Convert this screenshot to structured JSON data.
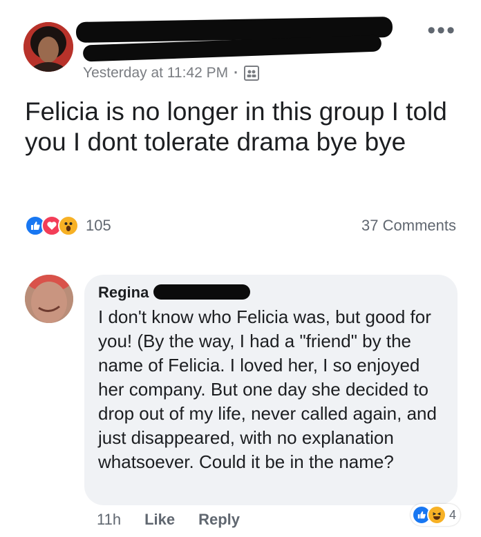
{
  "post": {
    "timestamp": "Yesterday at 11:42 PM",
    "separator": "·",
    "more_label": "•••",
    "text": "Felicia is no longer in this group I told you I dont tolerate drama bye bye",
    "reaction_count": "105",
    "comments_label": "37 Comments",
    "reactions": [
      "like",
      "love",
      "wow"
    ],
    "colors": {
      "like": "#1877f2",
      "love": "#f33e58",
      "wow": "#f7b125"
    }
  },
  "comment": {
    "author": "Regina",
    "text": "I don't know who Felicia was, but good for you! (By the way, I had a \"friend\" by the name of Felicia. I loved her, I so enjoyed her company. But one day she decided to drop out of my life, never called again, and just disappeared, with no explanation whatsoever. Could it be in the name?",
    "time": "11h",
    "like_label": "Like",
    "reply_label": "Reply",
    "reaction_count": "4",
    "reactions": [
      "like",
      "haha"
    ]
  }
}
